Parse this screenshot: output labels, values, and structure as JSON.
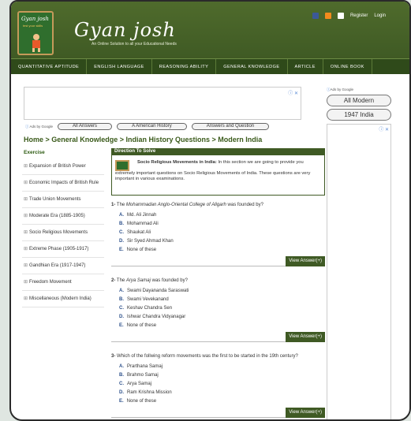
{
  "site": {
    "title": "Gyan josh",
    "tagline": "An Online Solution to all your Educational Needs",
    "logo_text": "Gyan josh",
    "logo_sub": "test your skills"
  },
  "top_links": {
    "register": "Register",
    "login": "Login"
  },
  "nav": [
    "QUANTITATIVE APTITUDE",
    "ENGLISH LANGUAGE",
    "REASONING ABILITY",
    "GENERAL KNOWLEDGE",
    "ARTICLE",
    "ONLINE BOOK"
  ],
  "ads": {
    "ads_by": "Ads by Google",
    "links": [
      "All Answers",
      "A American History",
      "Answers and Question"
    ],
    "close": "ⓘ ✕"
  },
  "breadcrumb": "Home > General Knowledge > Indian History Questions > Modern India",
  "sidebar": {
    "heading": "Exercise",
    "items": [
      "Expansion of British Power",
      "Economic Impacts of British Rule",
      "Trade Union Movements",
      "Moderate Era (1885-1905)",
      "Socio Religious Movements",
      "Extreme Phase (1905-1917)",
      "Gandhian Era (1917-1947)",
      "Freedom Movement",
      "Miscellaneous (Modern India)"
    ]
  },
  "direction": {
    "heading": "Direction To Solve",
    "bold": "Socio Religious Movements in India:",
    "text": " In this section we are going to provide you extremely important questions on Socio Religious Movements of India. These questions are very important in various examinations."
  },
  "questions": [
    {
      "num": "1-",
      "pre": " The ",
      "em": "Mohammadan Anglo-Oriental College of Aligarh",
      "post": " was founded by?",
      "options": [
        "Md. Ali Jinnah",
        "Mohammad Ali",
        "Shaukat Ali",
        "Sir Syed Ahmad Khan",
        "None of these"
      ]
    },
    {
      "num": "2-",
      "pre": " The ",
      "em": "Arya Samaj",
      "post": " was founded by?",
      "options": [
        "Swami Dayananda Saraswati",
        "Swami Vevekanand",
        "Keshav Chandra Sen",
        "Ishwar Chandra Vidyanagar",
        "None of these"
      ]
    },
    {
      "num": "3-",
      "pre": " Which of the follwing reform movements was the first to be started in the 19th century?",
      "em": "",
      "post": "",
      "options": [
        "Prarthana Samaj",
        "Brahmo Samaj",
        "Arya Samaj",
        "Ram Krishna Mission",
        "None of these"
      ]
    }
  ],
  "letters": [
    "A.",
    "B.",
    "C.",
    "D.",
    "E."
  ],
  "view_answer": "View Answer(+)",
  "right_ads": {
    "ads_by": "Ads by Google",
    "links": [
      "All Modern",
      "1947 India"
    ]
  }
}
